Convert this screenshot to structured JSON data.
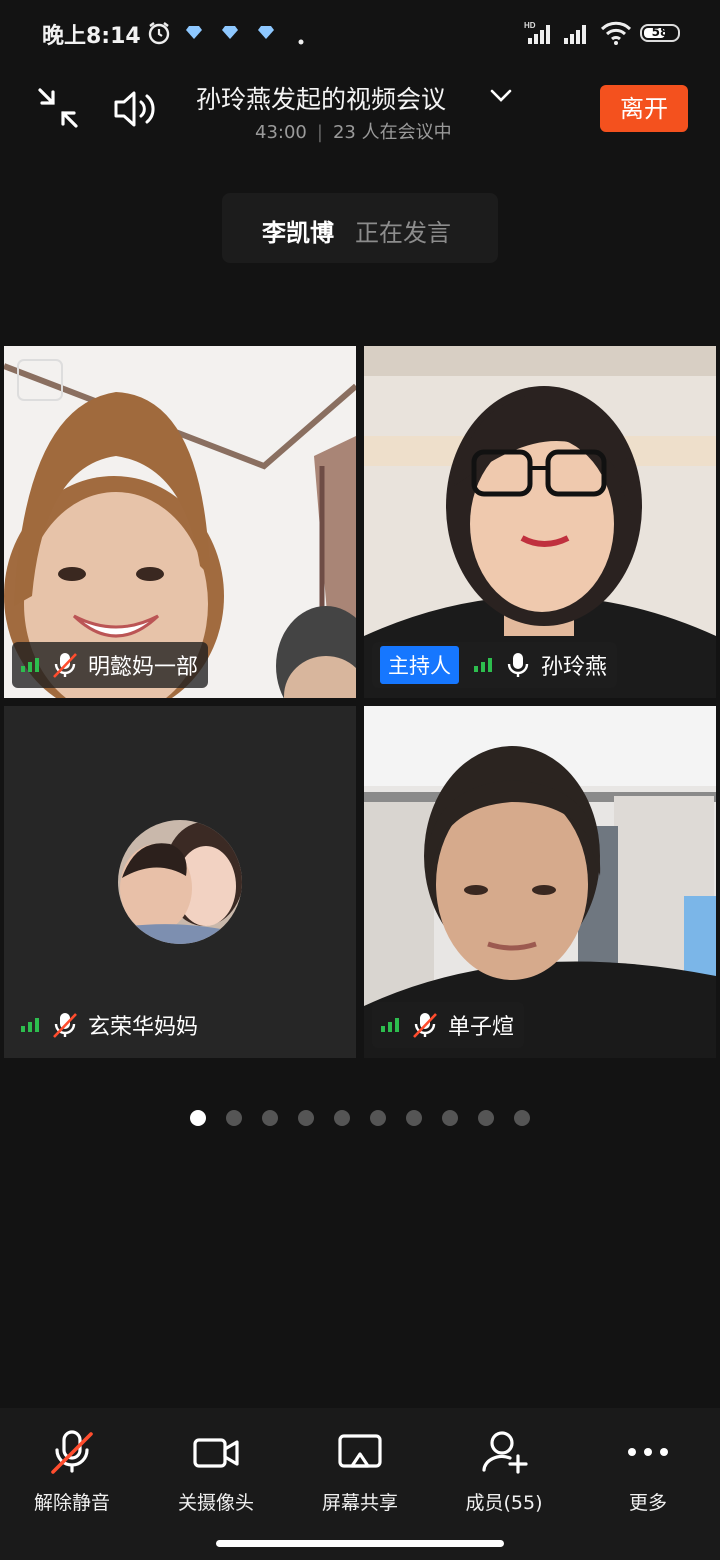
{
  "status_bar": {
    "time": "晚上8:14",
    "network_badge": "HD",
    "battery": "58",
    "icons": [
      "alarm-icon",
      "diamond-icon",
      "diamond-icon",
      "diamond-icon",
      "dot-icon",
      "signal-icon",
      "signal-icon",
      "wifi-icon",
      "battery-icon"
    ]
  },
  "header": {
    "title": "孙玲燕发起的视频会议",
    "duration": "43:00",
    "attendees": "23 人在会议中",
    "leave_label": "离开"
  },
  "speaker_banner": {
    "name": "李凯博",
    "status": "正在发言"
  },
  "tiles": [
    {
      "name": "明懿妈一部",
      "muted": true,
      "host": false
    },
    {
      "name": "孙玲燕",
      "muted": false,
      "host": true,
      "host_label": "主持人"
    },
    {
      "name": "玄荣华妈妈",
      "muted": true,
      "host": false,
      "video_off": true
    },
    {
      "name": "单子煊",
      "muted": true,
      "host": false
    }
  ],
  "pager": {
    "pages": 10,
    "current": 1
  },
  "toolbar": {
    "unmute_label": "解除静音",
    "camera_off_label": "关摄像头",
    "share_label": "屏幕共享",
    "members_label": "成员(55)",
    "more_label": "更多"
  },
  "colors": {
    "accent_leave": "#f4511e",
    "host_badge": "#1677ff",
    "signal_green": "#2dbd4e",
    "mute_slash": "#ff4d2e"
  }
}
